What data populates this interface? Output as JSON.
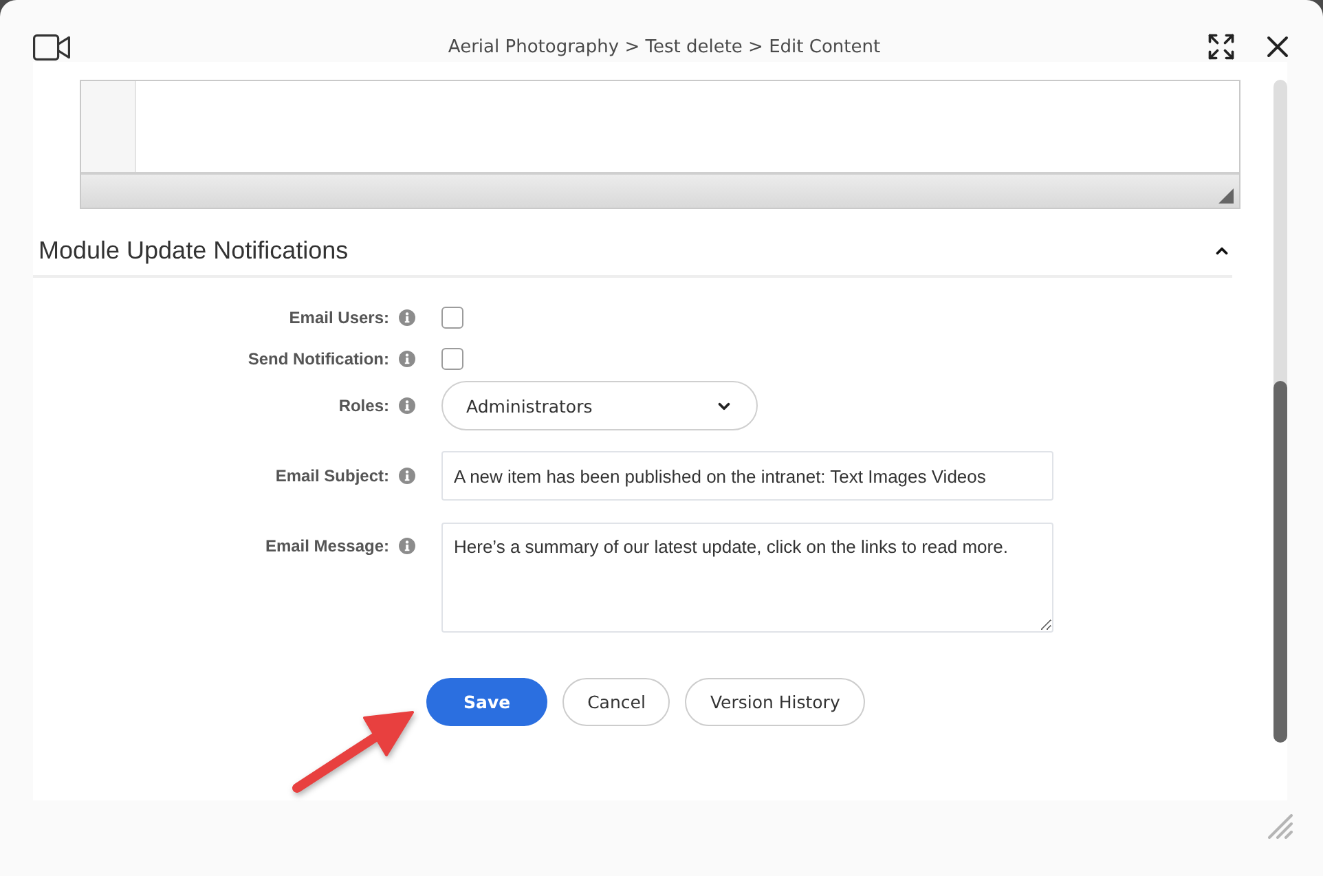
{
  "window": {
    "title": "Aerial Photography > Test delete > Edit Content"
  },
  "section": {
    "title": "Module Update Notifications",
    "expanded": true
  },
  "fields": [
    {
      "kind": "checkbox",
      "label": "Email Users:",
      "checked": false
    },
    {
      "kind": "checkbox",
      "label": "Send Notification:",
      "checked": false
    },
    {
      "kind": "select",
      "label": "Roles:",
      "value": "Administrators"
    },
    {
      "kind": "text",
      "label": "Email Subject:",
      "value": "A new item has been published on the intranet: Text Images Videos"
    },
    {
      "kind": "textarea",
      "label": "Email Message:",
      "value": "Here’s a summary of our latest update, click on the links to read more."
    }
  ],
  "buttons": [
    {
      "kind": "primary",
      "label": "Save"
    },
    {
      "kind": "secondary",
      "label": "Cancel"
    },
    {
      "kind": "secondary",
      "label": "Version History"
    }
  ]
}
